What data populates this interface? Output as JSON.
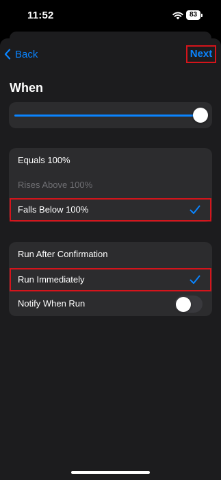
{
  "status_bar": {
    "time": "11:52",
    "battery_level": "83"
  },
  "nav": {
    "back_label": "Back",
    "next_label": "Next"
  },
  "page": {
    "title": "When"
  },
  "slider": {
    "value_fraction": 1.0
  },
  "condition_options": [
    {
      "label": "Equals 100%",
      "enabled": true,
      "selected": false
    },
    {
      "label": "Rises Above 100%",
      "enabled": false,
      "selected": false
    },
    {
      "label": "Falls Below 100%",
      "enabled": true,
      "selected": true
    }
  ],
  "action_options": [
    {
      "label": "Run After Confirmation",
      "selected": false
    },
    {
      "label": "Run Immediately",
      "selected": true
    }
  ],
  "notify": {
    "label": "Notify When Run",
    "enabled": false
  },
  "colors": {
    "accent": "#0a84ff",
    "highlight_box": "#d5141b",
    "card_background": "#2c2c2e",
    "sheet_background": "#1c1c1e"
  }
}
